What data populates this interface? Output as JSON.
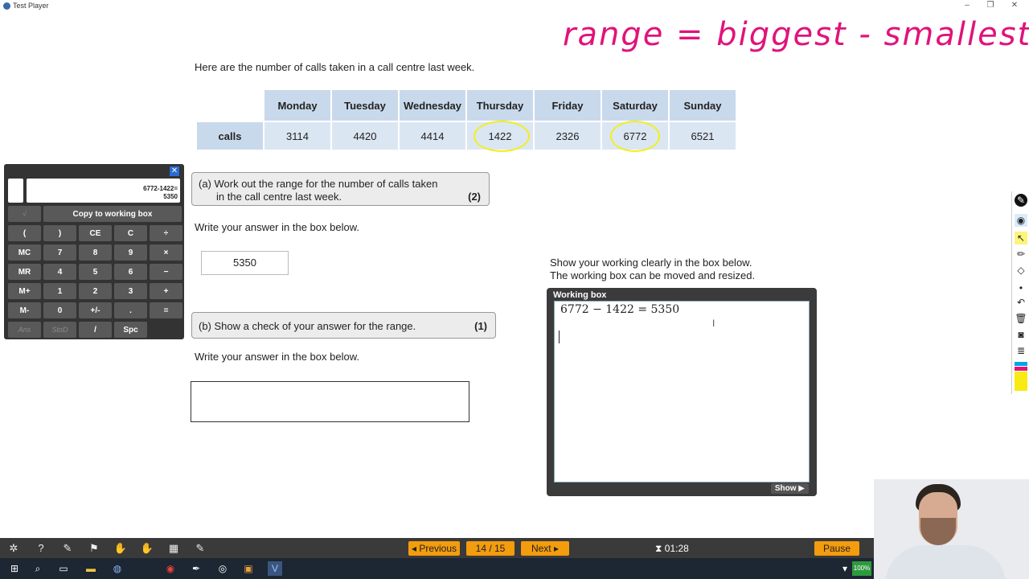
{
  "window": {
    "title": "Test Player"
  },
  "annotation": {
    "text": "range = biggest - smallest",
    "color": "#e0137b"
  },
  "question": {
    "intro": "Here are the number of calls taken in a call centre last week.",
    "table": {
      "days": [
        "Monday",
        "Tuesday",
        "Wednesday",
        "Thursday",
        "Friday",
        "Saturday",
        "Sunday"
      ],
      "row_label": "calls",
      "values": [
        "3114",
        "4420",
        "4414",
        "1422",
        "2326",
        "6772",
        "6521"
      ],
      "highlight_color": "#f2ef1a"
    },
    "part_a": {
      "label": "(a) Work out the range for the number of calls taken",
      "label_line2": "in the call centre last week.",
      "marks": "(2)",
      "write_instruction": "Write your answer in the box below.",
      "answer": "5350"
    },
    "part_b": {
      "label": "(b) Show a check of your answer for the range.",
      "marks": "(1)",
      "write_instruction": "Write your answer in the box below.",
      "answer": ""
    }
  },
  "calculator": {
    "display_line1": "6772-1422=",
    "display_line2": "5350",
    "sqrt_key": "√",
    "copy_label": "Copy to working box",
    "rows": [
      [
        "(",
        ")",
        "CE",
        "C",
        "÷"
      ],
      [
        "MC",
        "7",
        "8",
        "9",
        "×"
      ],
      [
        "MR",
        "4",
        "5",
        "6",
        "−"
      ],
      [
        "M+",
        "1",
        "2",
        "3",
        "+"
      ],
      [
        "M-",
        "0",
        "+/-",
        ".",
        "="
      ],
      [
        "Ans",
        "StoD",
        "/",
        "Spc"
      ]
    ]
  },
  "working": {
    "instruction_line1": "Show your working clearly in the box below.",
    "instruction_line2": "The working box can be moved and resized.",
    "title": "Working box",
    "equation": "6772 − 1422 = 5350",
    "show_label": "Show"
  },
  "navigation": {
    "previous": "Previous",
    "page": "14 / 15",
    "next": "Next",
    "timer": "01:28",
    "pause": "Pause",
    "accent": "#f39c0e"
  },
  "system_tray": {
    "battery": "100%"
  }
}
